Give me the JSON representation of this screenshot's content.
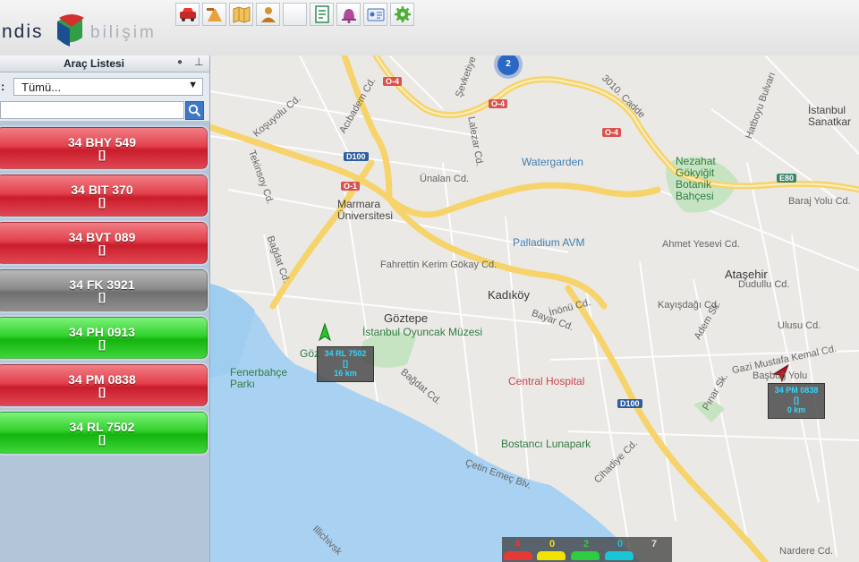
{
  "logo": {
    "left_text": "ndis",
    "right_text": "bilişim"
  },
  "toolbar": {
    "icons": [
      "car-icon",
      "road-works-icon",
      "map-icon",
      "driver-icon",
      "blank-icon",
      "report-icon",
      "alarm-bell-icon",
      "id-card-icon",
      "gear-icon"
    ]
  },
  "sidebar": {
    "title": "Araç Listesi",
    "filter_label": ":",
    "filter_value": "Tümü...",
    "search_placeholder": ""
  },
  "vehicles": [
    {
      "plate": "34 BHY 549",
      "sub": "[]",
      "status": "red"
    },
    {
      "plate": "34 BIT 370",
      "sub": "[]",
      "status": "red"
    },
    {
      "plate": "34 BVT 089",
      "sub": "[]",
      "status": "red"
    },
    {
      "plate": "34 FK 3921",
      "sub": "[]",
      "status": "gray"
    },
    {
      "plate": "34 PH 0913",
      "sub": "[]",
      "status": "green"
    },
    {
      "plate": "34 PM 0838",
      "sub": "[]",
      "status": "red"
    },
    {
      "plate": "34 RL 7502",
      "sub": "[]",
      "status": "green"
    }
  ],
  "map": {
    "cluster_count": "2",
    "districts": [
      "Kadıköy",
      "Göztepe",
      "Ataşehir"
    ],
    "pois": {
      "watergarden": "Watergarden",
      "palladium": "Palladium AVM",
      "marmara": "Marmara Üniversitesi",
      "museum": "İstanbul Oyuncak Müzesi",
      "hospital": "Central Hospital",
      "lunapark": "Bostancı Lunapark",
      "fenerbahce": "Fenerbahçe Parkı",
      "nezahat": "Nezahat Gökyiğit Botanik Bahçesi",
      "sanatkar": "İstanbul Sanatkar",
      "goz": "Göz"
    },
    "roads": {
      "o4a": "O-4",
      "o4b": "O-4",
      "o4c": "O-4",
      "o1": "O-1",
      "d100a": "D100",
      "d100b": "D100",
      "e80": "E80",
      "fahrettin": "Fahrettin Kerim Gökay Cd.",
      "bagdat": "Bağdat Cd.",
      "inonu": "İnönü Cd.",
      "bayar": "Bayar Cd.",
      "kayisdagi": "Kayışdağı Cd.",
      "ahmet": "Ahmet Yesevi Cd.",
      "baraj": "Baraj Yolu Cd.",
      "dudullu": "Dudullu Cd.",
      "ulusu": "Ulusu Cd.",
      "cetin": "Çetin Emeç Blv.",
      "cihadiye": "Cihadiye Cd.",
      "adem": "Adem Sk.",
      "pinar": "Pınar Sk.",
      "gazi": "Gazi Mustafa Kemal Cd.",
      "illichivsk": "Illichivsk",
      "sevketiye": "Şevketiye",
      "kosuyolu": "Koşuyolu Cd.",
      "acibadem": "Acıbadem Cd.",
      "lale": "Lalezar Cd.",
      "unalan": "Ünalan Cd.",
      "tekinsoy": "Tekinsoy Cd.",
      "hatboyu": "Hatboyu Bulvarı",
      "nadir": "Nardere Cd.",
      "caddesi3010": "3010. Cadde",
      "baslik": "Başbuğ Yolu"
    },
    "vehicle_markers": [
      {
        "plate": "34 RL 7502",
        "sub": "[]",
        "distance": "16 km"
      },
      {
        "plate": "34 PM 0838",
        "sub": "[]",
        "distance": "0 km"
      }
    ],
    "status_bar": {
      "counts": [
        "4",
        "0",
        "2",
        "0",
        "7"
      ],
      "colors": [
        "#e53935",
        "#f2e400",
        "#2ecc40",
        "#18c6d8",
        "#dddddd"
      ]
    }
  }
}
